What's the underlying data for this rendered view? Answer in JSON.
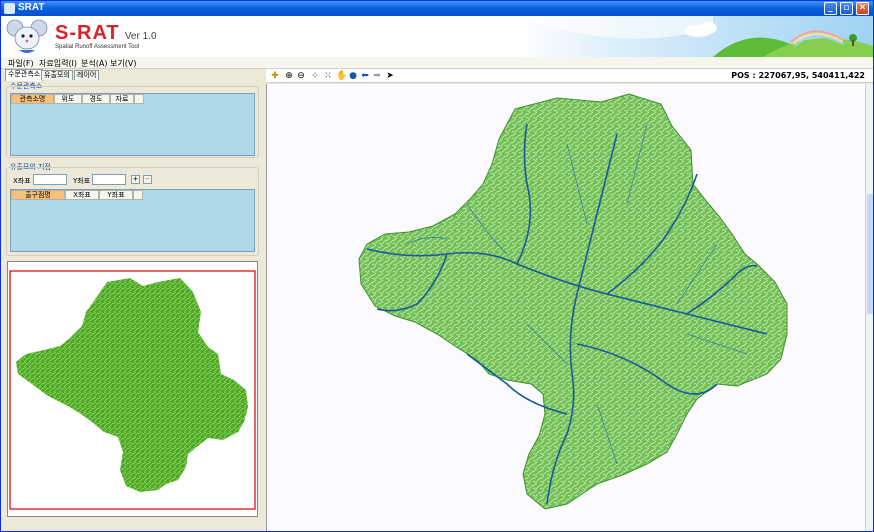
{
  "window": {
    "title": "SRAT"
  },
  "banner": {
    "logo_main": "S-RAT",
    "logo_ver": "Ver 1.0",
    "logo_sub": "Spatial Runoff Assessment Tool"
  },
  "menu": [
    {
      "label": "파일(F)"
    },
    {
      "label": "자료입력(I)"
    },
    {
      "label": "분석(A)"
    },
    {
      "label": "보기(V)"
    }
  ],
  "left_tabs": [
    {
      "label": "수문관측소"
    },
    {
      "label": "유출모의"
    },
    {
      "label": "레이어"
    }
  ],
  "station_group": {
    "title": "수문관측소",
    "columns": [
      "관측소명",
      "위도",
      "경도",
      "자료"
    ]
  },
  "sim_group": {
    "title": "유출모의 지점",
    "x_label": "X좌표",
    "y_label": "Y좌표",
    "add_symbol": "+",
    "remove_symbol": "−",
    "columns": [
      "출구점명",
      "X좌표",
      "Y좌표"
    ]
  },
  "toolbar": {
    "tools": [
      "add-layer-icon",
      "zoom-in-icon",
      "zoom-out-icon",
      "fixed-zoom-in-icon",
      "fixed-zoom-out-icon",
      "pan-icon",
      "full-extent-icon",
      "back-icon",
      "forward-icon",
      "select-icon"
    ],
    "pos_text": "POS : 227067,95,  540411,422"
  },
  "colors": {
    "title_bar": "#0a5fd8",
    "basin_green": "#4fa626",
    "basin_light": "#7cc86a",
    "stream_blue": "#1a5a9c",
    "grid_bg": "#add8e6",
    "overview_frame": "#d90000"
  }
}
